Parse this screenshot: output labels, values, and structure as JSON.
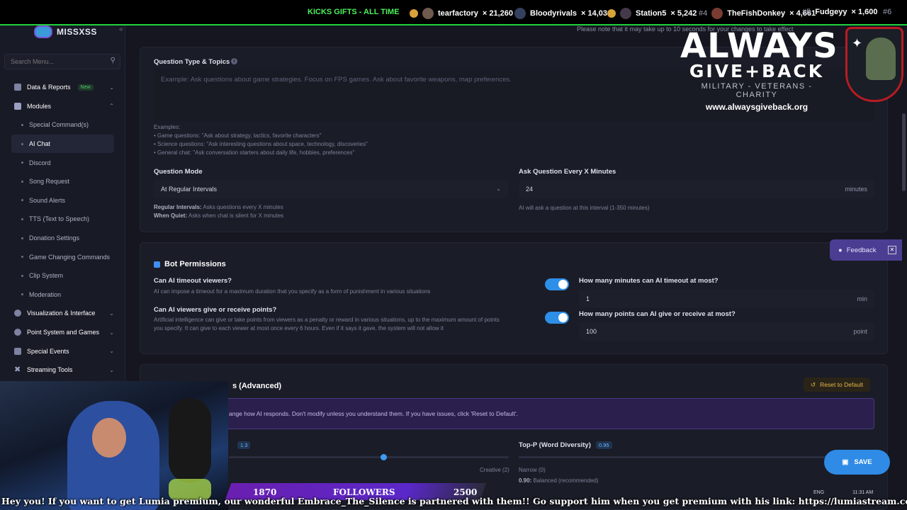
{
  "ticker": {
    "gifts_label": "KICKS GIFTS - ALL TIME",
    "entries": [
      {
        "rank": "",
        "name": "tearfactory",
        "count": "× 21,260"
      },
      {
        "rank": "",
        "name": "Bloodyrivals",
        "count": "× 14,031"
      },
      {
        "rank": "",
        "name": "Station5",
        "count": "× 5,242"
      },
      {
        "rank": "#4",
        "name": "TheFishDonkey",
        "count": "× 4,661"
      },
      {
        "rank": "#5",
        "name": "Fudgeyy",
        "count": "× 1,600"
      },
      {
        "rank": "#6",
        "name": "",
        "count": ""
      }
    ]
  },
  "sidebar": {
    "brand": "MISSXSS",
    "collapse_icon": "«",
    "search_placeholder": "Search Menu...",
    "items": [
      {
        "label": "Data & Reports",
        "badge": "New"
      },
      {
        "label": "Modules"
      },
      {
        "label": "Special Command(s)"
      },
      {
        "label": "AI Chat"
      },
      {
        "label": "Discord"
      },
      {
        "label": "Song Request"
      },
      {
        "label": "Sound Alerts"
      },
      {
        "label": "TTS (Text to Speech)"
      },
      {
        "label": "Donation Settings"
      },
      {
        "label": "Game Changing Commands"
      },
      {
        "label": "Clip System"
      },
      {
        "label": "Moderation"
      },
      {
        "label": "Visualization & Interface"
      },
      {
        "label": "Point System and Games"
      },
      {
        "label": "Special Events"
      },
      {
        "label": "Streaming Tools"
      }
    ]
  },
  "main": {
    "notice": "Please note that it may take up to 10 seconds for your changes to take effect",
    "question_type": {
      "label": "Question Type & Topics",
      "placeholder": "Example: Ask questions about game strategies. Focus on FPS games. Ask about favorite weapons, map preferences.",
      "examples_title": "Examples:",
      "examples": [
        "• Game questions: \"Ask about strategy, tactics, favorite characters\"",
        "• Science questions: \"Ask interesting questions about space, technology, discoveries\"",
        "• General chat: \"Ask conversation starters about daily life, hobbies, preferences\""
      ]
    },
    "question_mode": {
      "label": "Question Mode",
      "value": "At Regular Intervals",
      "help1_bold": "Regular Intervals:",
      "help1": " Asks questions every X minutes",
      "help2_bold": "When Quiet:",
      "help2": " Asks when chat is silent for X minutes"
    },
    "ask_every": {
      "label": "Ask Question Every X Minutes",
      "value": "24",
      "unit": "minutes",
      "help": "AI will ask a question at this interval (1-350 minutes)"
    },
    "bot_permissions": {
      "title": "Bot Permissions",
      "timeout_q": "Can AI timeout viewers?",
      "timeout_desc": "AI can impose a timeout for a maximum duration that you specify as a form of punishment in various situations",
      "points_q": "Can AI viewers give or receive points?",
      "points_desc1": "Artificial intelligence can give or take points from viewers as a penalty or reward in various situations, up to the maximum amount of points",
      "points_desc2": "you specify. It can give to each viewer at most once every 6 hours. Even if it says it gave, the system will not allow it",
      "timeout_max_label": "How many minutes can AI timeout at most?",
      "timeout_max_value": "1",
      "timeout_unit": "min",
      "points_max_label": "How many points can AI give or receive at most?",
      "points_max_value": "100",
      "points_unit": "point"
    },
    "advanced": {
      "title": "s (Advanced)",
      "reset_label": "Reset to Default",
      "warning": "ange how AI responds. Don't modify unless you understand them. If you have issues, click 'Reset to Default'.",
      "temp_label_tail": ")",
      "temp_value": "1.3",
      "temp_right": "Creative (2)",
      "topp_label": "Top-P (Word Diversity)",
      "topp_value": "0.95",
      "topp_left": "Narrow (0)",
      "topp_note_bold": "0.90:",
      "topp_note": " Balanced (recommended)"
    },
    "feedback_label": "Feedback",
    "save_label": "SAVE"
  },
  "overlay": {
    "logo_line1": "ALWAYS",
    "logo_line2": "GIVE+BACK",
    "tagline": "MILITARY - VETERANS - CHARITY",
    "url": "www.alwaysgiveback.org",
    "follow_left": "1870",
    "follow_mid": "FOLLOWERS",
    "follow_right": "2500",
    "scroll_text": "Hey you! If you want to get Lumia premium, our wonderful Embrace_The_Silence is partnered with them!! Go support him when you get premium with his link: https://lumiastream.com/ref/ETS",
    "clock": "11:31 AM",
    "lang": "ENG"
  }
}
